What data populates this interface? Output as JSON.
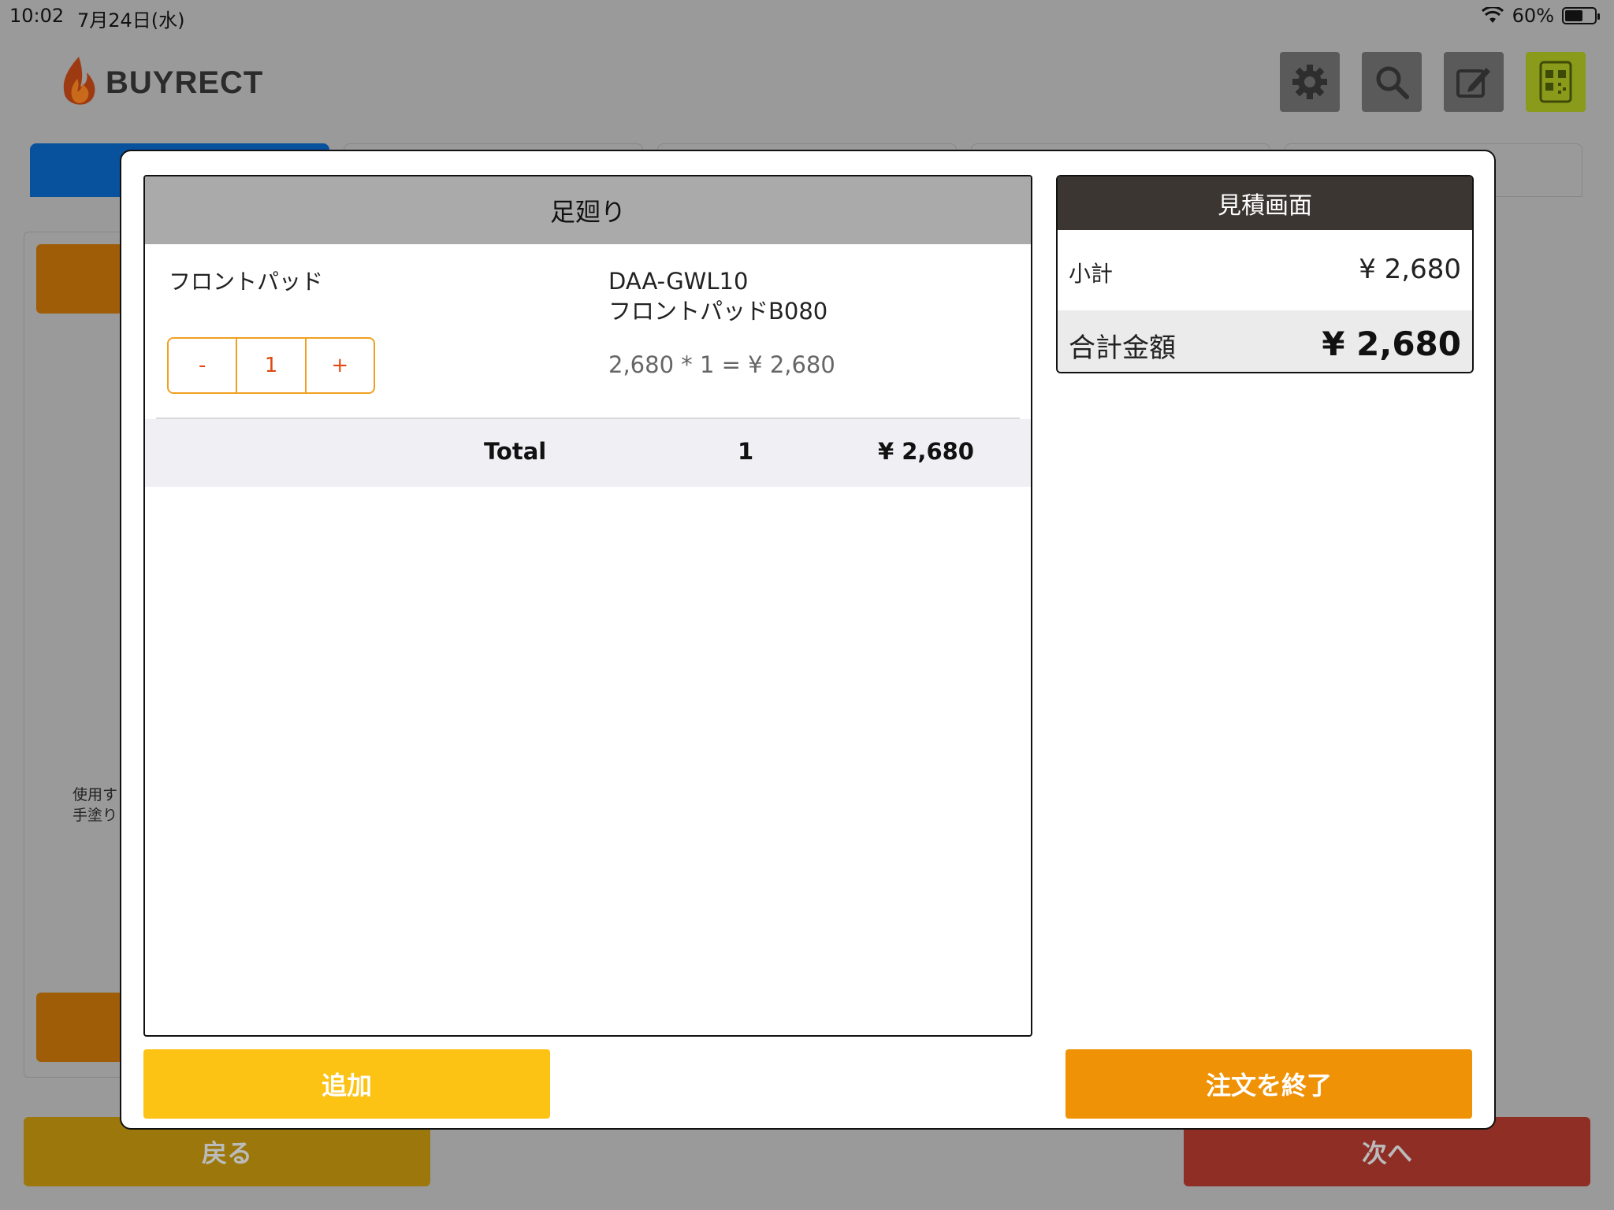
{
  "status": {
    "time": "10:02",
    "date": "7月24日(水)",
    "battery": "60%"
  },
  "header": {
    "logo_text": "BUYRECT",
    "buttons": [
      {
        "name": "settings-button",
        "icon": "gear-icon"
      },
      {
        "name": "search-button",
        "icon": "search-icon"
      },
      {
        "name": "edit-button",
        "icon": "edit-icon"
      },
      {
        "name": "qr-button",
        "icon": "qr-code-icon"
      }
    ]
  },
  "background": {
    "text_line1": "使用す",
    "text_line2": "手塗り",
    "back_label": "戻る",
    "next_label": "次へ",
    "colors": {
      "back": "#9c780c",
      "next": "#8e2e25",
      "active_tab": "#08519d"
    }
  },
  "modal": {
    "list_title": "足廻り",
    "items": [
      {
        "name": "フロントパッド",
        "code": "DAA-GWL10",
        "description": "フロントパッドB080",
        "qty": "1",
        "minus": "-",
        "plus": "+",
        "calc": "2,680 * 1 = ¥ 2,680"
      }
    ],
    "total": {
      "label": "Total",
      "qty": "1",
      "amount": "¥ 2,680"
    },
    "summary": {
      "title": "見積画面",
      "subtotal_label": "小計",
      "subtotal_value": "¥ 2,680",
      "grand_label": "合計金額",
      "grand_value": "¥ 2,680"
    },
    "add_label": "追加",
    "finish_label": "注文を終了",
    "colors": {
      "add": "#fcc214",
      "finish": "#f09206",
      "summary_header": "#3b3632"
    }
  }
}
